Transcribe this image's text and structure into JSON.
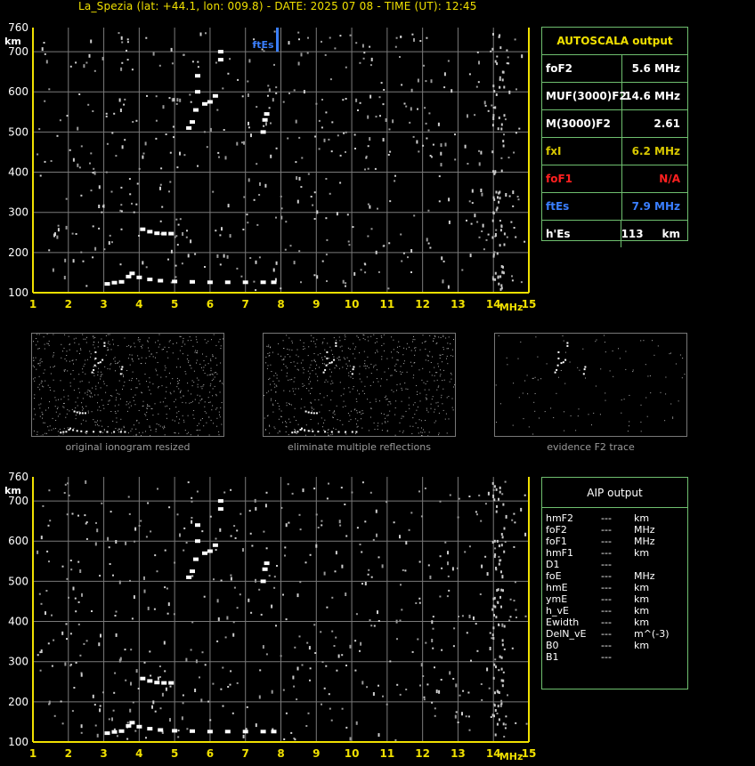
{
  "header": {
    "title": "La_Spezia (lat: +44.1, lon: 009.8) - DATE: 2025 07 08 - TIME (UT): 12:45"
  },
  "colors": {
    "axis": "#f0e000",
    "grid": "#7a7a7a",
    "frame": "#6fbf6f",
    "trace": "#ffffff",
    "ftes": "#3a7fff",
    "fof1": "#ff2020",
    "fxi": "#d8c800"
  },
  "autoscala": {
    "title": "AUTOSCALA output",
    "rows": [
      {
        "label": "foF2",
        "value": "5.6 MHz",
        "color": "#ffffff"
      },
      {
        "label": "MUF(3000)F2",
        "value": "14.6 MHz",
        "color": "#ffffff"
      },
      {
        "label": "M(3000)F2",
        "value": "2.61",
        "color": "#ffffff"
      },
      {
        "label": "fxI",
        "value": "6.2 MHz",
        "color": "#d8c800"
      },
      {
        "label": "foF1",
        "value": "N/A",
        "color": "#ff2020"
      },
      {
        "label": "ftEs",
        "value": "7.9 MHz",
        "color": "#3a7fff"
      },
      {
        "label": "h'Es",
        "value": "113     km",
        "color": "#ffffff"
      }
    ]
  },
  "aip": {
    "title": "AIP output",
    "rows": [
      {
        "label": "hmF2",
        "value": "---",
        "unit": "km"
      },
      {
        "label": "foF2",
        "value": "---",
        "unit": "MHz"
      },
      {
        "label": "foF1",
        "value": "---",
        "unit": "MHz"
      },
      {
        "label": "hmF1",
        "value": "---",
        "unit": "km"
      },
      {
        "label": "D1",
        "value": "---",
        "unit": ""
      },
      {
        "label": "foE",
        "value": "---",
        "unit": "MHz"
      },
      {
        "label": "hmE",
        "value": "---",
        "unit": "km"
      },
      {
        "label": "ymE",
        "value": "---",
        "unit": "km"
      },
      {
        "label": "h_vE",
        "value": "---",
        "unit": "km"
      },
      {
        "label": "Ewidth",
        "value": "---",
        "unit": "km"
      },
      {
        "label": "DelN_vE",
        "value": "---",
        "unit": "m^(-3)"
      },
      {
        "label": "B0",
        "value": "---",
        "unit": "km"
      },
      {
        "label": "B1",
        "value": "---",
        "unit": ""
      }
    ]
  },
  "thumbnails": [
    {
      "caption": "original ionogram resized"
    },
    {
      "caption": "eliminate multiple reflections"
    },
    {
      "caption": "evidence F2 trace"
    }
  ],
  "chart_data": [
    {
      "type": "scatter",
      "title": "",
      "xlabel": "MHz",
      "ylabel": "km",
      "xlim": [
        1,
        15
      ],
      "ylim": [
        100,
        760
      ],
      "xticks": [
        1,
        2,
        3,
        4,
        5,
        6,
        7,
        8,
        9,
        10,
        11,
        12,
        13,
        14,
        15
      ],
      "yticks": [
        100,
        200,
        300,
        400,
        500,
        600,
        700,
        760
      ],
      "grid": true,
      "series": [
        {
          "values": [
            {
              "x": 3.1,
              "y": 122
            },
            {
              "x": 3.3,
              "y": 125
            },
            {
              "x": 3.5,
              "y": 127
            },
            {
              "x": 3.7,
              "y": 140
            },
            {
              "x": 3.8,
              "y": 148
            },
            {
              "x": 4.0,
              "y": 138
            },
            {
              "x": 4.3,
              "y": 133
            },
            {
              "x": 4.6,
              "y": 130
            },
            {
              "x": 5.0,
              "y": 128
            },
            {
              "x": 5.5,
              "y": 127
            },
            {
              "x": 6.0,
              "y": 126
            },
            {
              "x": 6.5,
              "y": 126
            },
            {
              "x": 7.0,
              "y": 126
            },
            {
              "x": 7.5,
              "y": 126
            },
            {
              "x": 7.8,
              "y": 126
            },
            {
              "x": 4.1,
              "y": 258
            },
            {
              "x": 4.3,
              "y": 252
            },
            {
              "x": 4.5,
              "y": 248
            },
            {
              "x": 4.7,
              "y": 247
            },
            {
              "x": 4.9,
              "y": 247
            },
            {
              "x": 5.4,
              "y": 510
            },
            {
              "x": 5.5,
              "y": 525
            },
            {
              "x": 5.6,
              "y": 555
            },
            {
              "x": 5.65,
              "y": 600
            },
            {
              "x": 5.65,
              "y": 640
            },
            {
              "x": 5.85,
              "y": 570
            },
            {
              "x": 6.0,
              "y": 575
            },
            {
              "x": 6.15,
              "y": 590
            },
            {
              "x": 6.3,
              "y": 680
            },
            {
              "x": 6.3,
              "y": 700
            },
            {
              "x": 7.5,
              "y": 500
            },
            {
              "x": 7.55,
              "y": 530
            },
            {
              "x": 7.6,
              "y": 545
            }
          ]
        },
        {
          "name": "ftEs",
          "values": [
            {
              "x": 7.9,
              "y": 700
            },
            {
              "x": 7.9,
              "y": 760
            }
          ]
        }
      ]
    },
    {
      "type": "scatter",
      "title": "",
      "xlabel": "MHz",
      "ylabel": "km",
      "xlim": [
        1,
        15
      ],
      "ylim": [
        100,
        760
      ],
      "xticks": [
        1,
        2,
        3,
        4,
        5,
        6,
        7,
        8,
        9,
        10,
        11,
        12,
        13,
        14,
        15
      ],
      "yticks": [
        100,
        200,
        300,
        400,
        500,
        600,
        700,
        760
      ],
      "grid": true,
      "series": [
        {
          "values": [
            {
              "x": 3.1,
              "y": 122
            },
            {
              "x": 3.3,
              "y": 125
            },
            {
              "x": 3.5,
              "y": 127
            },
            {
              "x": 3.7,
              "y": 140
            },
            {
              "x": 3.8,
              "y": 148
            },
            {
              "x": 4.0,
              "y": 138
            },
            {
              "x": 4.3,
              "y": 133
            },
            {
              "x": 4.6,
              "y": 130
            },
            {
              "x": 5.0,
              "y": 128
            },
            {
              "x": 5.5,
              "y": 127
            },
            {
              "x": 6.0,
              "y": 126
            },
            {
              "x": 6.5,
              "y": 126
            },
            {
              "x": 7.0,
              "y": 126
            },
            {
              "x": 7.5,
              "y": 126
            },
            {
              "x": 7.8,
              "y": 126
            },
            {
              "x": 4.1,
              "y": 258
            },
            {
              "x": 4.3,
              "y": 252
            },
            {
              "x": 4.5,
              "y": 248
            },
            {
              "x": 4.7,
              "y": 247
            },
            {
              "x": 4.9,
              "y": 247
            },
            {
              "x": 5.4,
              "y": 510
            },
            {
              "x": 5.5,
              "y": 525
            },
            {
              "x": 5.6,
              "y": 555
            },
            {
              "x": 5.65,
              "y": 600
            },
            {
              "x": 5.65,
              "y": 640
            },
            {
              "x": 5.85,
              "y": 570
            },
            {
              "x": 6.0,
              "y": 575
            },
            {
              "x": 6.15,
              "y": 590
            },
            {
              "x": 6.3,
              "y": 680
            },
            {
              "x": 6.3,
              "y": 700
            },
            {
              "x": 7.5,
              "y": 500
            },
            {
              "x": 7.55,
              "y": 530
            },
            {
              "x": 7.6,
              "y": 545
            }
          ]
        }
      ]
    }
  ]
}
